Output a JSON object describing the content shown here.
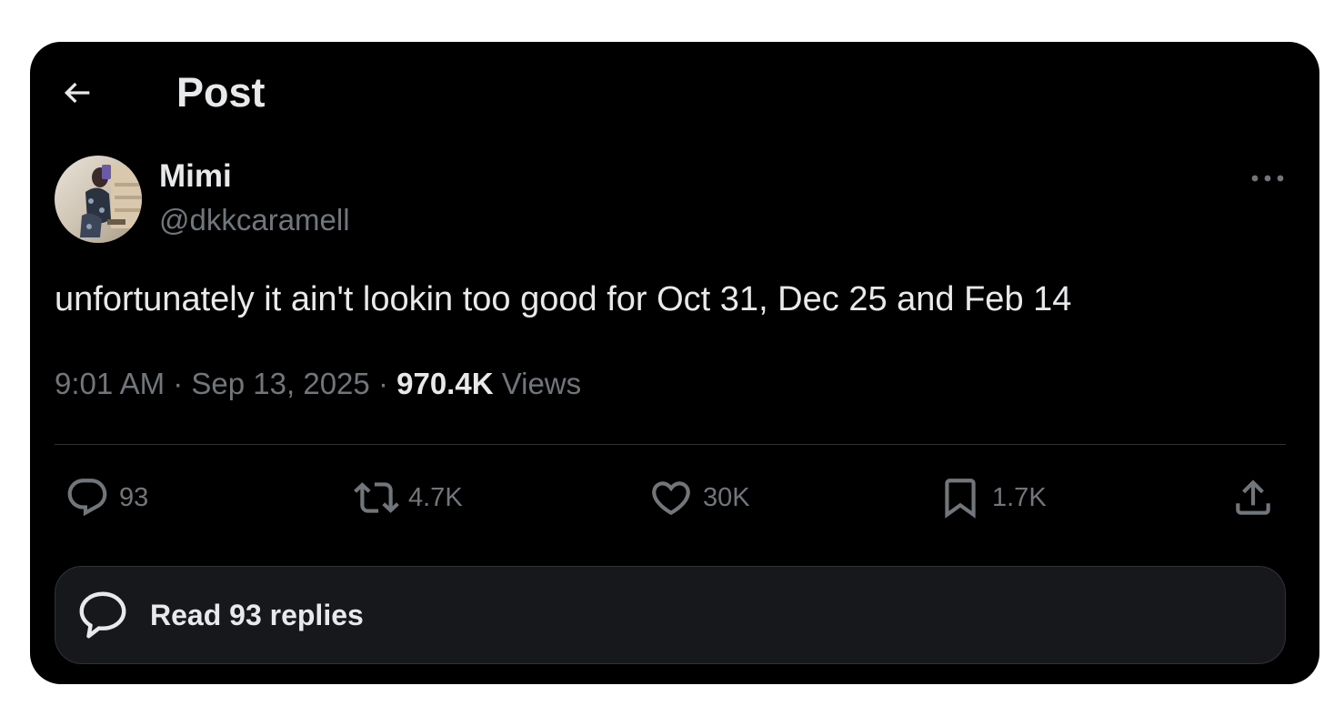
{
  "header": {
    "title": "Post"
  },
  "author": {
    "display_name": "Mimi",
    "handle": "@dkkcaramell"
  },
  "post": {
    "text": "unfortunately it ain't lookin too good for Oct 31, Dec 25 and Feb 14",
    "time": "9:01 AM",
    "separator": "·",
    "date": "Sep 13, 2025",
    "views_count": "970.4K",
    "views_label": "Views"
  },
  "actions": {
    "replies": "93",
    "reposts": "4.7K",
    "likes": "30K",
    "bookmarks": "1.7K"
  },
  "read_replies": {
    "label": "Read 93 replies"
  },
  "icons": {
    "back": "arrow-left-icon",
    "more": "more-horizontal-icon",
    "reply": "reply-icon",
    "repost": "repost-icon",
    "like": "heart-icon",
    "bookmark": "bookmark-icon",
    "share": "share-icon",
    "read_replies": "speech-bubble-icon"
  },
  "colors": {
    "background": "#000000",
    "text_primary": "#e7e9ea",
    "text_secondary": "#71767b",
    "divider": "#2f3336"
  }
}
